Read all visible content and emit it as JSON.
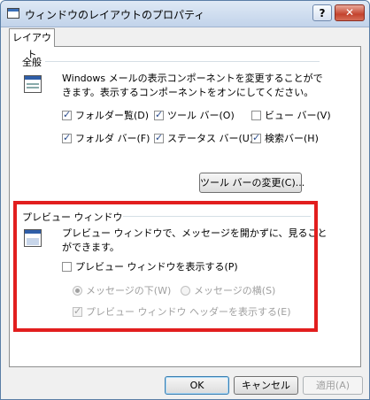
{
  "window": {
    "title": "ウィンドウのレイアウトのプロパティ",
    "help_label": "?",
    "close_label": "✕"
  },
  "tab": {
    "label": "レイアウト"
  },
  "general": {
    "title": "全般",
    "desc_line1": "Windows メールの表示コンポーネントを変更することがで",
    "desc_line2": "きます。表示するコンポーネントをオンにしてください。",
    "checkboxes": [
      {
        "label": "フォルダー覧(D)",
        "checked": true
      },
      {
        "label": "ツール バー(O)",
        "checked": true
      },
      {
        "label": "ビュー バー(V)",
        "checked": false
      },
      {
        "label": "フォルダ バー(F)",
        "checked": true
      },
      {
        "label": "ステータス バー(U)",
        "checked": true
      },
      {
        "label": "検索バー(H)",
        "checked": true
      }
    ],
    "toolbar_button_label": "ツール バーの変更(C)..."
  },
  "preview": {
    "title": "プレビュー ウィンドウ",
    "desc_line1": "プレビュー ウィンドウで、メッセージを開かずに、見ること",
    "desc_line2": "ができます。",
    "show_checkbox_label": "プレビュー ウィンドウを表示する(P)",
    "radio_below_label": "メッセージの下(W)",
    "radio_side_label": "メッセージの横(S)",
    "header_checkbox_label": "プレビュー ウィンドウ ヘッダーを表示する(E)"
  },
  "buttons": {
    "ok": "OK",
    "cancel": "キャンセル",
    "apply": "適用(A)"
  },
  "colors": {
    "highlight": "#e21e1e",
    "close_button": "#c4432e"
  }
}
